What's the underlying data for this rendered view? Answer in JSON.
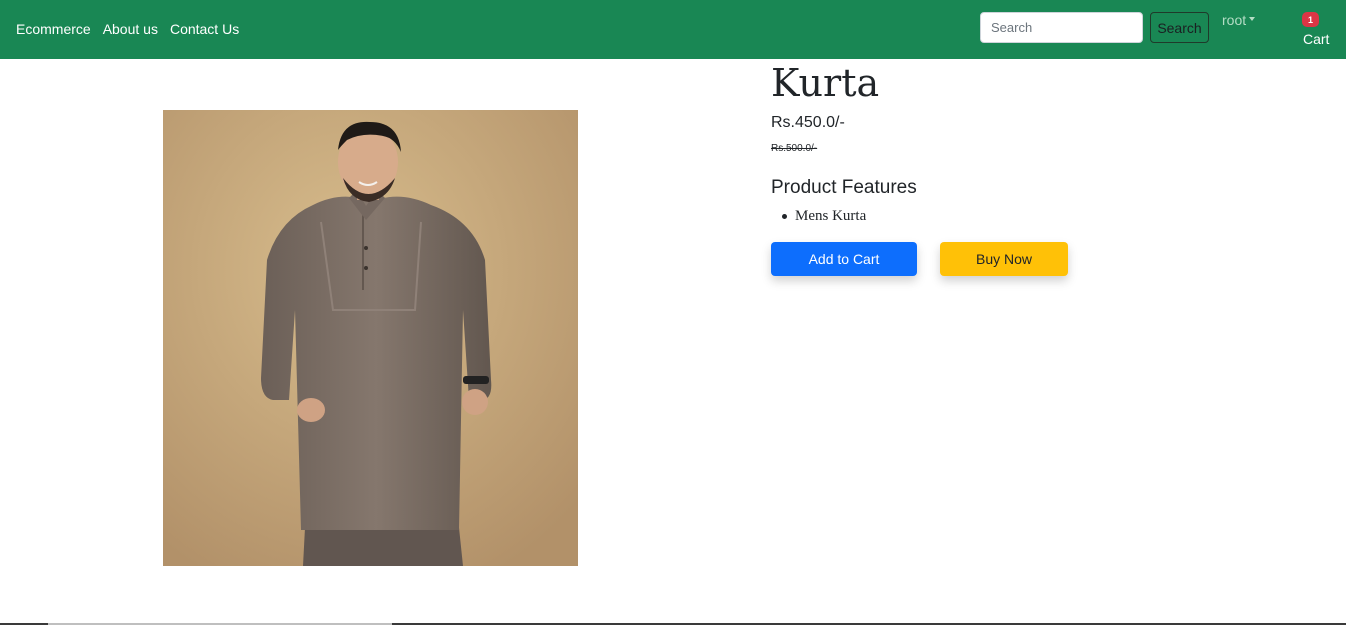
{
  "nav": {
    "links": [
      "Ecommerce",
      "About us",
      "Contact Us"
    ],
    "search_placeholder": "Search",
    "search_button": "Search",
    "user": "root",
    "cart_count": "1",
    "cart_label": "Cart"
  },
  "product": {
    "title": "Kurta",
    "price": "Rs.450.0/-",
    "original_price": "Rs.500.0/-",
    "features_heading": "Product Features",
    "features": [
      "Mens Kurta"
    ],
    "add_to_cart": "Add to Cart",
    "buy_now": "Buy Now"
  },
  "colors": {
    "navbar": "#198754",
    "primary_button": "#0d6efd",
    "warning_button": "#ffc107",
    "badge": "#dc3545"
  },
  "icons": [
    "caret-down-icon"
  ]
}
